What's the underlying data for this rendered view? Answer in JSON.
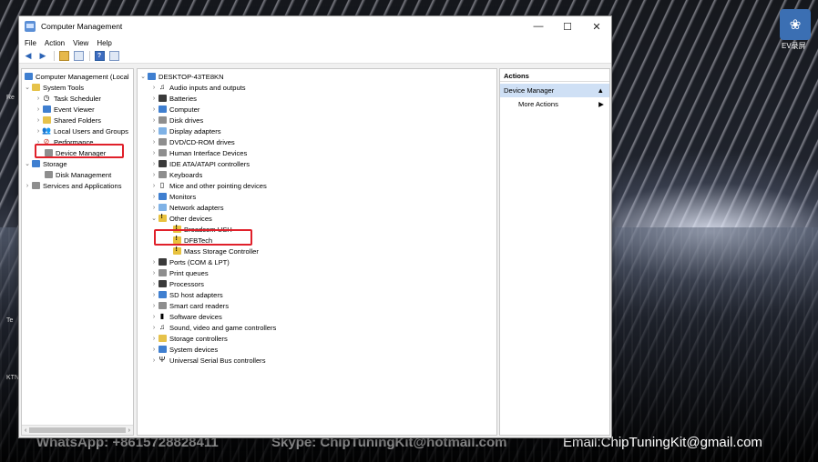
{
  "window": {
    "title": "Computer Management",
    "controls": {
      "minimize": "—",
      "maximize": "☐",
      "close": "✕"
    }
  },
  "menu": [
    "File",
    "Action",
    "View",
    "Help"
  ],
  "left_tree": {
    "root": "Computer Management (Local",
    "system_tools": "System Tools",
    "items": [
      "Task Scheduler",
      "Event Viewer",
      "Shared Folders",
      "Local Users and Groups",
      "Performance",
      "Device Manager"
    ],
    "storage": "Storage",
    "disk_management": "Disk Management",
    "services": "Services and Applications"
  },
  "device_tree": {
    "computer": "DESKTOP-43TE8KN",
    "categories_top": [
      "Audio inputs and outputs",
      "Batteries",
      "Computer",
      "Disk drives",
      "Display adapters",
      "DVD/CD-ROM drives",
      "Human Interface Devices",
      "IDE ATA/ATAPI controllers",
      "Keyboards",
      "Mice and other pointing devices",
      "Monitors",
      "Network adapters"
    ],
    "other_devices": "Other devices",
    "other_children": [
      "Broadcom USH",
      "DFBTech",
      "Mass Storage Controller"
    ],
    "categories_bottom": [
      "Ports (COM & LPT)",
      "Print queues",
      "Processors",
      "SD host adapters",
      "Smart card readers",
      "Software devices",
      "Sound, video and game controllers",
      "Storage controllers",
      "System devices",
      "Universal Serial Bus controllers"
    ]
  },
  "actions": {
    "header": "Actions",
    "section": "Device Manager",
    "item": "More Actions"
  },
  "desktop": {
    "tray_label": "EV录屏",
    "watermark_left": "WhatsApp: +8615728828411",
    "watermark_mid": "Skype: ChipTuningKit@hotmail.com",
    "watermark_email": "Email:ChipTuningKit@gmail.com",
    "edge_labels": [
      "Re",
      "Te",
      "KTN"
    ]
  },
  "colors": {
    "highlight_box": "#e0202a",
    "actions_section_bg": "#cfe0f5"
  }
}
